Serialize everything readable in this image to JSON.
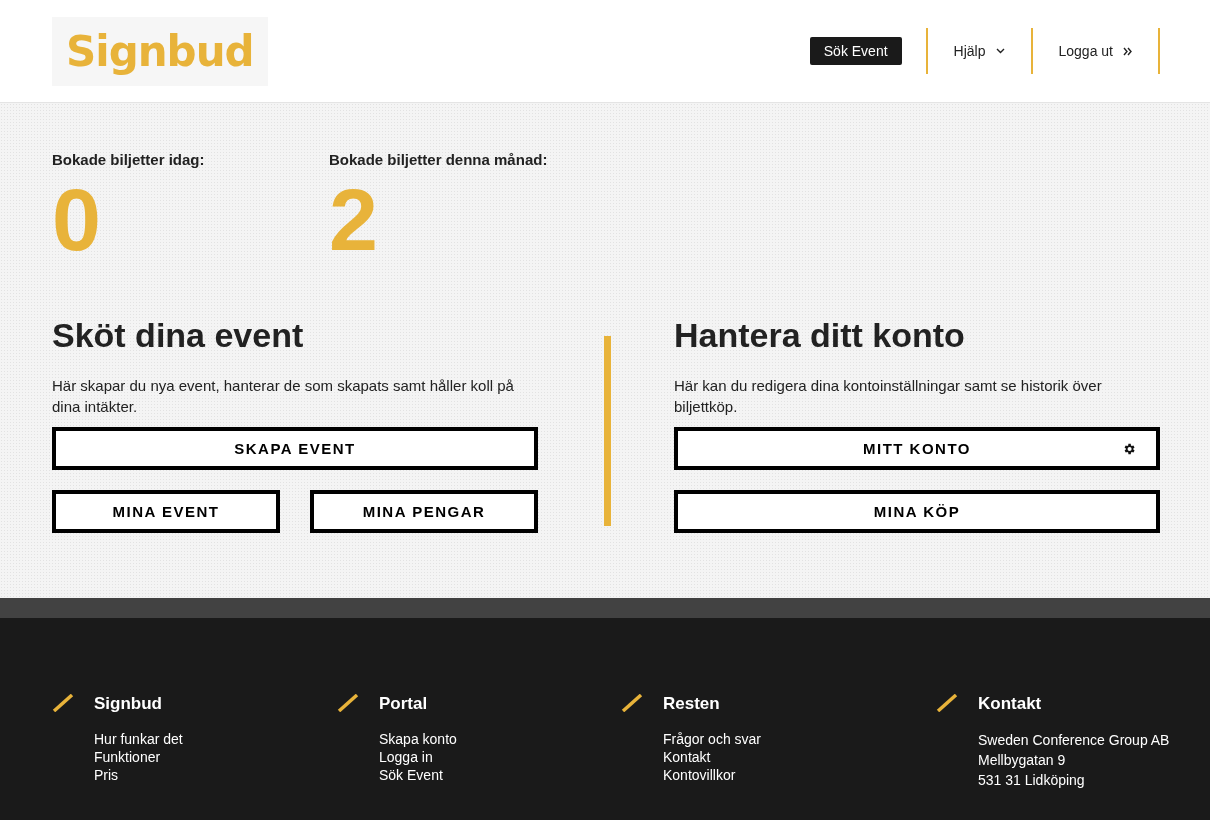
{
  "header": {
    "logo": "Signbud",
    "nav": [
      {
        "label": "Sök Event",
        "kind": "button"
      },
      {
        "label": "Hjälp",
        "kind": "dropdown"
      },
      {
        "label": "Logga ut",
        "kind": "link"
      }
    ]
  },
  "stats": [
    {
      "label": "Bokade biljetter idag:",
      "value": "0"
    },
    {
      "label": "Bokade biljetter denna månad:",
      "value": "2"
    }
  ],
  "sections": [
    {
      "title": "Sköt dina event",
      "text": "Här skapar du nya event, hanterar de som skapats samt håller koll på dina intäkter.",
      "rows": [
        [
          {
            "label": "SKAPA EVENT",
            "kind": "plain"
          }
        ],
        [
          {
            "label": "MINA EVENT",
            "kind": "plain"
          },
          {
            "label": "MINA PENGAR",
            "kind": "plain"
          }
        ]
      ]
    },
    {
      "title": "Hantera ditt konto",
      "text": "Här kan du redigera dina kontoinställningar samt se historik över biljettköp.",
      "rows": [
        [
          {
            "label": "MITT KONTO",
            "kind": "settings"
          }
        ],
        [
          {
            "label": "MINA KÖP",
            "kind": "plain"
          }
        ]
      ]
    }
  ],
  "footer": [
    {
      "title": "Signbud",
      "kind": "links",
      "lines": [
        "Hur funkar det",
        "Funktioner",
        "Pris"
      ]
    },
    {
      "title": "Portal",
      "kind": "links",
      "lines": [
        "Skapa konto",
        "Logga in",
        "Sök Event"
      ]
    },
    {
      "title": "Resten",
      "kind": "links",
      "lines": [
        "Frågor och svar",
        "Kontakt",
        "Kontovillkor"
      ]
    },
    {
      "title": "Kontakt",
      "kind": "address",
      "lines": [
        "Sweden Conference Group AB",
        "Mellbygatan 9",
        "531 31 Lidköping"
      ]
    }
  ]
}
